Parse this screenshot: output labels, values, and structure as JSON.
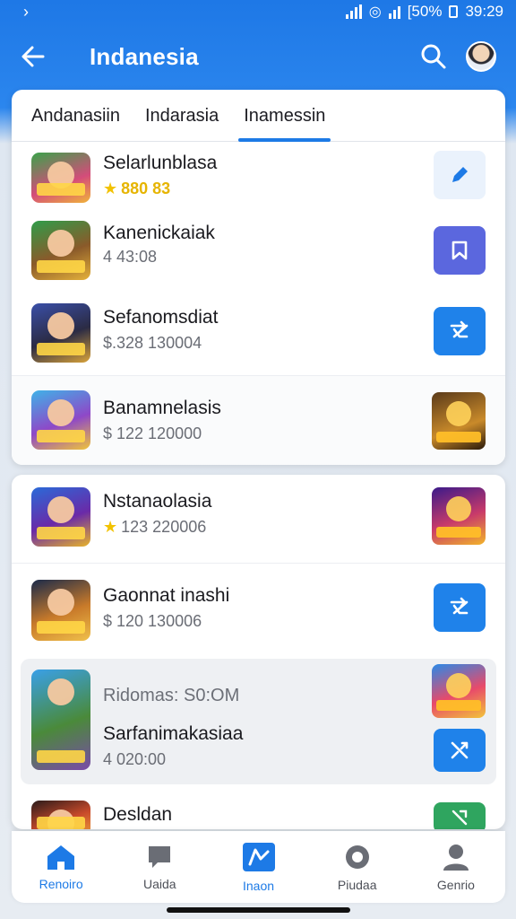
{
  "status_bar": {
    "battery": "[50%",
    "time": "39:29"
  },
  "app_bar": {
    "title": "Indanesia"
  },
  "tabs": [
    {
      "label": "Andanasiin",
      "active": false
    },
    {
      "label": "Indarasia",
      "active": false
    },
    {
      "label": "Inamessin",
      "active": true
    }
  ],
  "list_top": [
    {
      "title": "Selarlunblasa",
      "subtitle": "880 83",
      "subtitle_rating": true,
      "action": "edit"
    },
    {
      "title": "Kanenickaiak",
      "subtitle": "4 43:08",
      "subtitle_rating": false,
      "action": "bookmark"
    },
    {
      "title": "Sefanomsdiat",
      "subtitle": "$.328 130004",
      "subtitle_rating": false,
      "action": "shuffle"
    },
    {
      "title": "Banamnelasis",
      "subtitle": "$ 122 120000",
      "subtitle_rating": false,
      "action": "game"
    }
  ],
  "list_bottom": [
    {
      "title": "Nstanaolasia",
      "subtitle": "123 220006",
      "subtitle_rating": true,
      "action": "game"
    },
    {
      "title": "Gaonnat inashi",
      "subtitle": "$ 120 130006",
      "subtitle_rating": false,
      "action": "shuffle"
    },
    {
      "title": "Sarfanimakasiaa",
      "subtitle": "4 020:00",
      "header": "Ridomas: S0:OM",
      "action": "shuffle"
    },
    {
      "title": "Desldan",
      "subtitle": "",
      "action": "green"
    }
  ],
  "bottom_nav": [
    {
      "label": "Renoiro",
      "icon": "home-icon",
      "active": false
    },
    {
      "label": "Uaida",
      "icon": "chat-icon",
      "active": false
    },
    {
      "label": "Inaon",
      "icon": "store-icon",
      "active": true
    },
    {
      "label": "Piudaa",
      "icon": "settings-icon",
      "active": false
    },
    {
      "label": "Genrio",
      "icon": "profile-icon",
      "active": false
    }
  ],
  "colors": {
    "accent": "#1d7ae6",
    "star": "#f2c200",
    "purple": "#5b67de",
    "green": "#2fa55f"
  }
}
